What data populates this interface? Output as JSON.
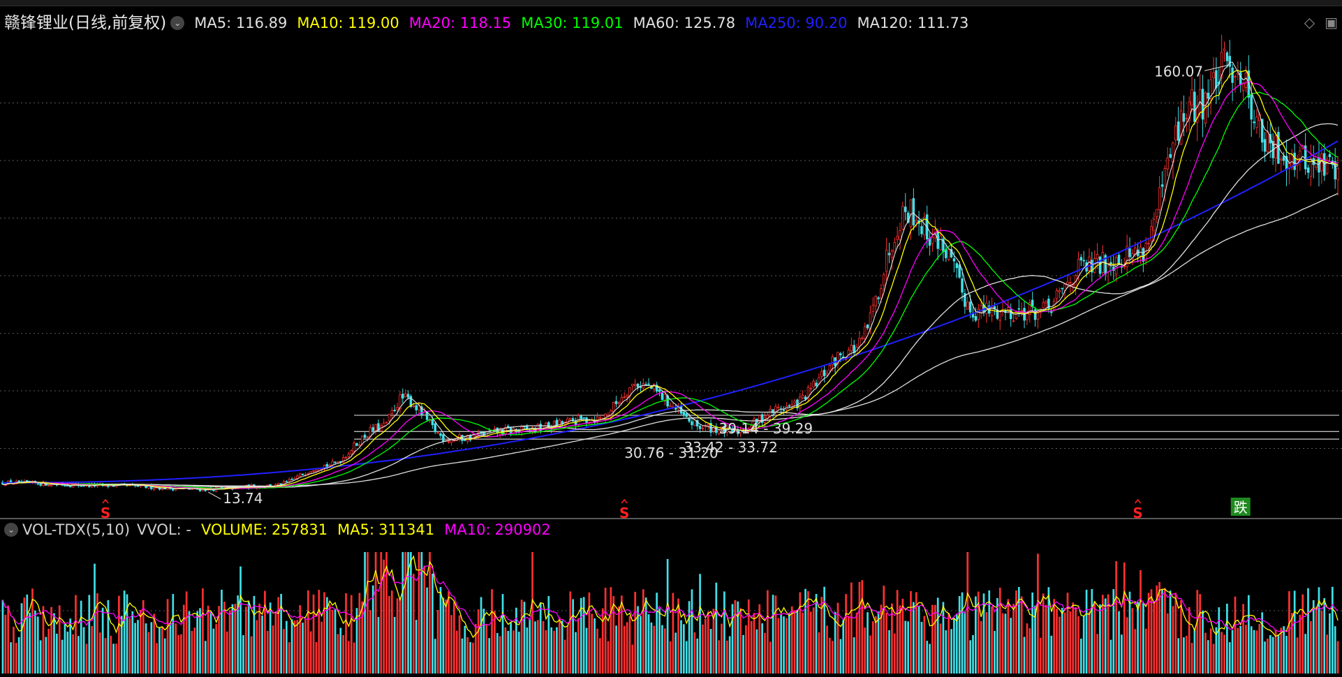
{
  "stock_name": "赣锋锂业",
  "period_label": "(日线,前复权)",
  "price_legend": [
    {
      "label": "MA5:",
      "value": "116.89",
      "color": "#e0e0e0"
    },
    {
      "label": "MA10:",
      "value": "119.00",
      "color": "#ffff00"
    },
    {
      "label": "MA20:",
      "value": "118.15",
      "color": "#ff00ff"
    },
    {
      "label": "MA30:",
      "value": "119.01",
      "color": "#00ff00"
    },
    {
      "label": "MA60:",
      "value": "125.78",
      "color": "#e0e0e0"
    },
    {
      "label": "MA250:",
      "value": "90.20",
      "color": "#2020ff"
    },
    {
      "label": "MA120:",
      "value": "111.73",
      "color": "#e0e0e0"
    }
  ],
  "volume_legend": {
    "indicator": "VOL-TDX(5,10)",
    "vvol": "VVOL: -",
    "volume_label": "VOLUME:",
    "volume_value": "257831",
    "ma5_label": "MA5:",
    "ma5_value": "311341",
    "ma10_label": "MA10:",
    "ma10_value": "290902"
  },
  "colors": {
    "up": "#ff3030",
    "down": "#40e0e8",
    "ma250": "#2020ff",
    "white_ma": "#e0e0e0",
    "yellow_ma": "#ffff00",
    "magenta_ma": "#ff00ff",
    "green_ma": "#00ff00"
  },
  "chart_data": {
    "type": "candlestick",
    "price_range": [
      8,
      170
    ],
    "key_points": [
      {
        "index": 0,
        "close": 16
      },
      {
        "index": 40,
        "close": 15
      },
      {
        "index": 75,
        "close": 13.74
      },
      {
        "index": 100,
        "close": 15
      },
      {
        "index": 120,
        "close": 22
      },
      {
        "index": 140,
        "close": 35
      },
      {
        "index": 148,
        "close": 45
      },
      {
        "index": 165,
        "close": 31
      },
      {
        "index": 190,
        "close": 34
      },
      {
        "index": 220,
        "close": 38
      },
      {
        "index": 235,
        "close": 50
      },
      {
        "index": 260,
        "close": 35
      },
      {
        "index": 270,
        "close": 33.5
      },
      {
        "index": 290,
        "close": 42
      },
      {
        "index": 315,
        "close": 62
      },
      {
        "index": 335,
        "close": 110
      },
      {
        "index": 345,
        "close": 100
      },
      {
        "index": 360,
        "close": 75
      },
      {
        "index": 385,
        "close": 75
      },
      {
        "index": 400,
        "close": 90
      },
      {
        "index": 420,
        "close": 95
      },
      {
        "index": 440,
        "close": 145
      },
      {
        "index": 455,
        "close": 160.07
      },
      {
        "index": 470,
        "close": 130
      },
      {
        "index": 490,
        "close": 125
      }
    ],
    "annotations": [
      {
        "text": "160.07",
        "index": 455,
        "price": 160.07
      },
      {
        "text": "13.74",
        "index": 75,
        "price": 13.74
      },
      {
        "text": "30.76 - 31.20",
        "index": 210,
        "price": 31.0
      },
      {
        "text": "33.42 - 33.72",
        "index": 280,
        "price": 33.5
      },
      {
        "text": "39.14 - 39.29",
        "index": 290,
        "price": 39.2
      }
    ],
    "levels": [
      39.2,
      33.6,
      31.0
    ],
    "signals": [
      {
        "index": 38,
        "text": "S"
      },
      {
        "index": 230,
        "text": "S"
      },
      {
        "index": 420,
        "text": "S"
      },
      {
        "index": 458,
        "text": "跌"
      }
    ]
  }
}
